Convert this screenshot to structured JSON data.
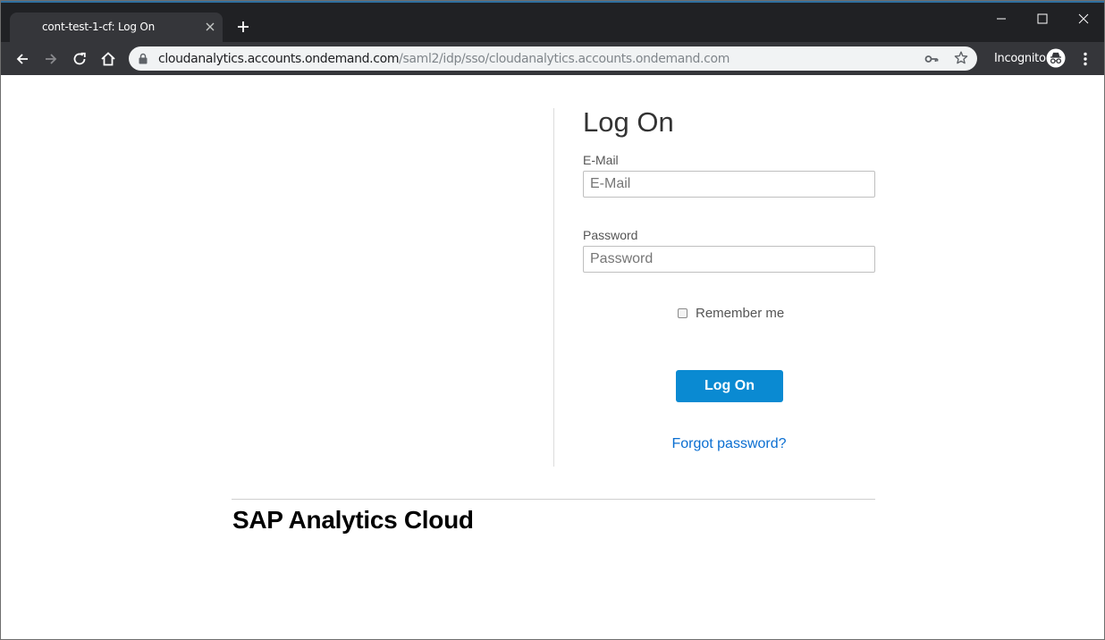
{
  "browser": {
    "tab": {
      "title": "cont-test-1-cf: Log On"
    },
    "address_bar": {
      "host": "cloudanalytics.accounts.ondemand.com",
      "path": "/saml2/idp/sso/cloudanalytics.accounts.ondemand.com"
    },
    "profile_label": "Incognito",
    "icons": {
      "tab_close": "close-icon",
      "new_tab": "plus-icon",
      "minimize": "minimize-icon",
      "maximize": "maximize-icon",
      "close": "close-icon",
      "back": "arrow-left-icon",
      "forward": "arrow-right-icon",
      "reload": "reload-icon",
      "home": "home-icon",
      "lock": "lock-icon",
      "passwords": "key-icon",
      "bookmark": "star-icon",
      "incognito": "incognito-icon",
      "menu": "kebab-menu-icon"
    },
    "colors": {
      "chrome_dark": "#202124",
      "toolbar": "#35363a",
      "omnibox": "#f1f3f4"
    }
  },
  "login": {
    "title": "Log On",
    "email": {
      "label": "E-Mail",
      "placeholder": "E-Mail",
      "value": ""
    },
    "password": {
      "label": "Password",
      "placeholder": "Password",
      "value": ""
    },
    "remember_me": {
      "label": "Remember me",
      "checked": false
    },
    "submit_label": "Log On",
    "forgot_password": "Forgot password?"
  },
  "footer": {
    "brand": "SAP Analytics Cloud"
  },
  "colors": {
    "primary_button": "#0a8ad2",
    "link": "#0a6ed1"
  }
}
